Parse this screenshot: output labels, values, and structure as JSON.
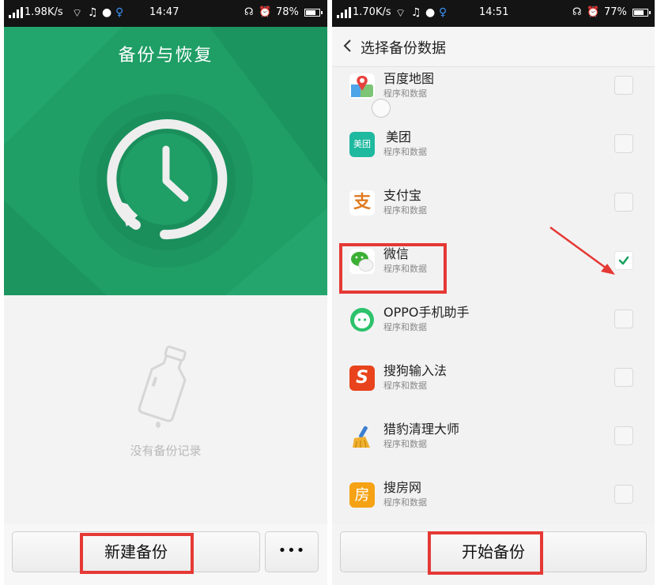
{
  "left_screen": {
    "status": {
      "speed": "1.98K/s",
      "time": "14:47",
      "battery": "78%",
      "battery_level": 0.78
    },
    "title": "备份与恢复",
    "empty_text": "没有备份记录",
    "new_backup_label": "新建备份",
    "more_label": "•••"
  },
  "right_screen": {
    "status": {
      "speed": "1.70K/s",
      "time": "14:51",
      "battery": "77%",
      "battery_level": 0.77
    },
    "title": "选择备份数据",
    "apps": [
      {
        "name": "百度地图",
        "sub": "程序和数据",
        "icon": "baidu-map-icon",
        "checked": false
      },
      {
        "name": "美团",
        "sub": "程序和数据",
        "icon": "meituan-icon",
        "icon_text": "美团",
        "checked": false
      },
      {
        "name": "支付宝",
        "sub": "程序和数据",
        "icon": "alipay-icon",
        "icon_text": "支",
        "checked": false
      },
      {
        "name": "微信",
        "sub": "程序和数据",
        "icon": "wechat-icon",
        "checked": true
      },
      {
        "name": "OPPO手机助手",
        "sub": "程序和数据",
        "icon": "oppo-assistant-icon",
        "checked": false
      },
      {
        "name": "搜狗输入法",
        "sub": "程序和数据",
        "icon": "sogou-input-icon",
        "icon_text": "S",
        "checked": false
      },
      {
        "name": "猎豹清理大师",
        "sub": "程序和数据",
        "icon": "cleaner-broom-icon",
        "checked": false
      },
      {
        "name": "搜房网",
        "sub": "程序和数据",
        "icon": "soufun-icon",
        "icon_text": "房",
        "checked": false
      }
    ],
    "start_backup_label": "开始备份"
  },
  "colors": {
    "brand_green": "#1f9e66",
    "highlight_red": "#e53935",
    "check_green": "#17a05d"
  }
}
